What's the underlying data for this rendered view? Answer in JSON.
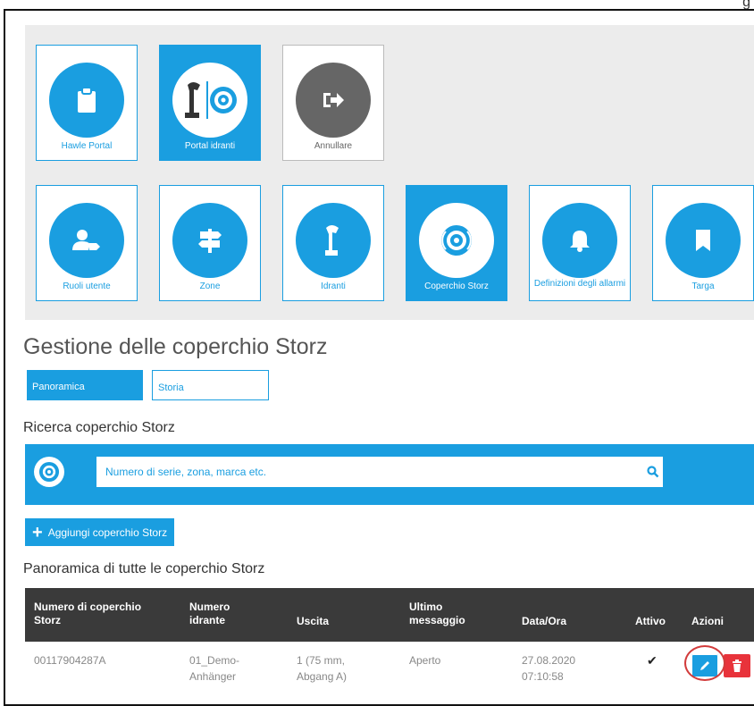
{
  "corner_text": "g",
  "top_tiles": [
    {
      "label": "Hawle Portal",
      "icon": "clipboard-icon"
    },
    {
      "label": "Portal idranti",
      "icon": "hydrant-logo-icon"
    },
    {
      "label": "Annullare",
      "icon": "sign-out-icon"
    }
  ],
  "menu_tiles": [
    {
      "label": "Ruoli utente",
      "icon": "user-tag-icon"
    },
    {
      "label": "Zone",
      "icon": "signpost-icon"
    },
    {
      "label": "Idranti",
      "icon": "hydrant-icon"
    },
    {
      "label": "Coperchio Storz",
      "icon": "storz-cover-icon"
    },
    {
      "label": "Definizioni degli allarmi",
      "icon": "bell-icon"
    },
    {
      "label": "Targa",
      "icon": "bookmark-icon"
    }
  ],
  "page_title": "Gestione delle coperchio Storz",
  "tabs": [
    "Panoramica",
    "Storia"
  ],
  "search": {
    "title": "Ricerca coperchio Storz",
    "placeholder": "Numero di serie, zona, marca etc."
  },
  "add_button": {
    "label": "Aggiungi coperchio Storz"
  },
  "table": {
    "title": "Panoramica di tutte le coperchio Storz",
    "headers": [
      "Numero di coperchio Storz",
      "Numero idrante",
      "Uscita",
      "Ultimo messaggio",
      "Data/Ora",
      "Attivo",
      "Azioni"
    ],
    "rows": [
      {
        "numero": "00117904287A",
        "idrante": "01_Demo-Anhänger",
        "uscita": "1 (75 mm, Abgang A)",
        "messaggio": "Aperto",
        "data": "27.08.2020 07:10:58",
        "attivo": "✔"
      }
    ]
  },
  "colors": {
    "accent": "#1a9ee0",
    "danger": "#e8333b",
    "header": "#3a3a3a",
    "highlight": "#d23c3c"
  }
}
